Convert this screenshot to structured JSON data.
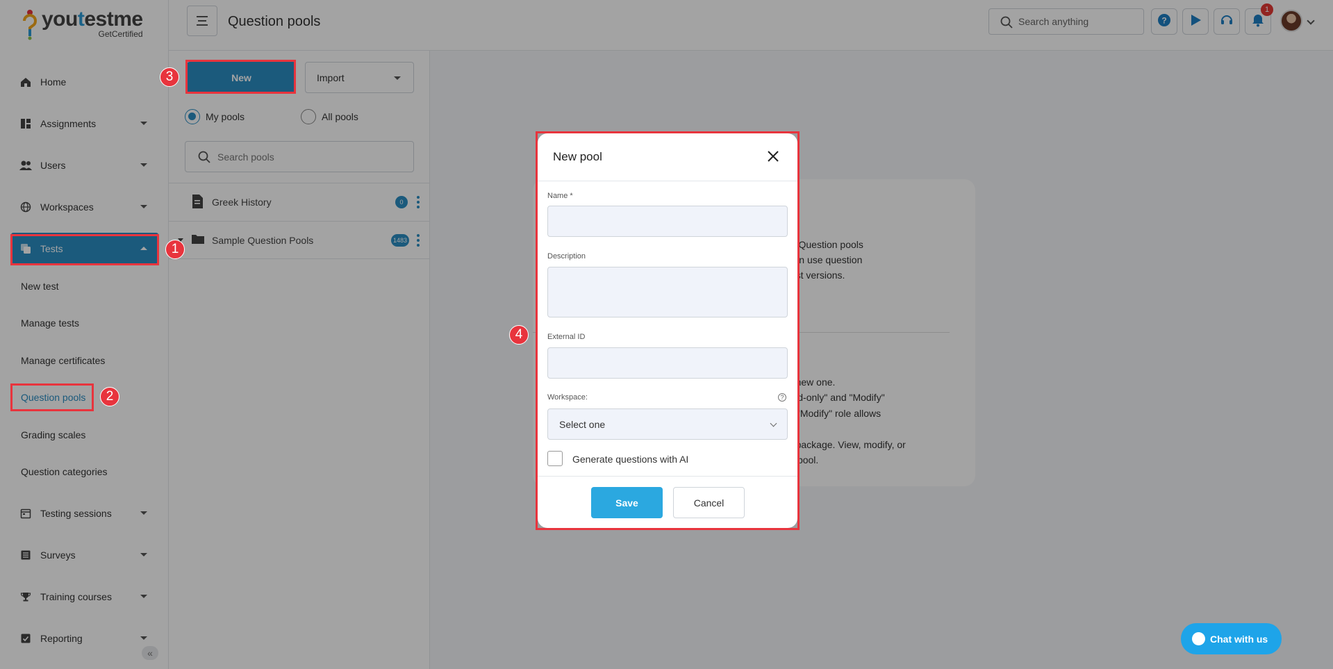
{
  "brand": {
    "name_part1": "you",
    "name_part2": "t",
    "name_part3": "estme",
    "tagline": "GetCertified"
  },
  "sidebar": {
    "items": [
      {
        "label": "Home",
        "icon": "home-icon"
      },
      {
        "label": "Assignments",
        "icon": "assignments-icon"
      },
      {
        "label": "Users",
        "icon": "users-icon"
      },
      {
        "label": "Workspaces",
        "icon": "globe-icon"
      },
      {
        "label": "Tests",
        "icon": "tests-icon"
      },
      {
        "label": "Testing sessions",
        "icon": "calendar-icon"
      },
      {
        "label": "Surveys",
        "icon": "surveys-icon"
      },
      {
        "label": "Training courses",
        "icon": "trophy-icon"
      },
      {
        "label": "Reporting",
        "icon": "reporting-icon"
      }
    ],
    "subitems": [
      "New test",
      "Manage tests",
      "Manage certificates",
      "Question pools",
      "Grading scales",
      "Question categories"
    ]
  },
  "header": {
    "title": "Question pools",
    "search_placeholder": "Search anything",
    "notification_count": "1"
  },
  "pools": {
    "new_label": "New",
    "import_label": "Import",
    "radio_my": "My pools",
    "radio_all": "All pools",
    "search_placeholder": "Search pools",
    "rows": [
      {
        "name": "Greek History",
        "count": "0"
      },
      {
        "name": "Sample Question Pools",
        "count": "1483"
      }
    ]
  },
  "info": {
    "lines": [
      "ons in pools. Question pools",
      "nized. You can use question",
      "generated test versions.",
      "t or create a new one.",
      "een the \"Read-only\" and \"Modify\"",
      "in tests. The \"Modify\" role allows",
      "e or the QTI package. View, modify, or",
      "her question pool."
    ]
  },
  "modal": {
    "title": "New pool",
    "name_label": "Name",
    "required_mark": "*",
    "description_label": "Description",
    "external_id_label": "External ID",
    "workspace_label": "Workspace:",
    "workspace_value": "Select one",
    "help_glyph": "?",
    "ai_label": "Generate questions with AI",
    "save_label": "Save",
    "cancel_label": "Cancel"
  },
  "chat": {
    "label": "Chat with us"
  },
  "callouts": [
    "1",
    "2",
    "3",
    "4"
  ],
  "colors": {
    "accent": "#2b8dc2",
    "callout": "#e8343d",
    "save": "#2ba8e0"
  }
}
